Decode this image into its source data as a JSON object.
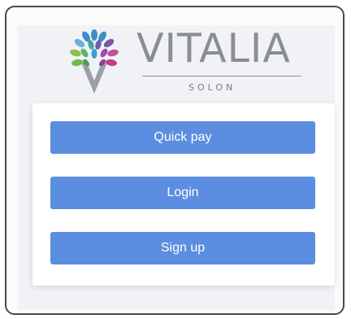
{
  "logo": {
    "brand": "VITALIA",
    "location": "SOLON"
  },
  "actions": {
    "quick_pay": "Quick pay",
    "login": "Login",
    "sign_up": "Sign up"
  },
  "colors": {
    "button": "#5b8ee0",
    "brand_text": "#8a8d93"
  }
}
